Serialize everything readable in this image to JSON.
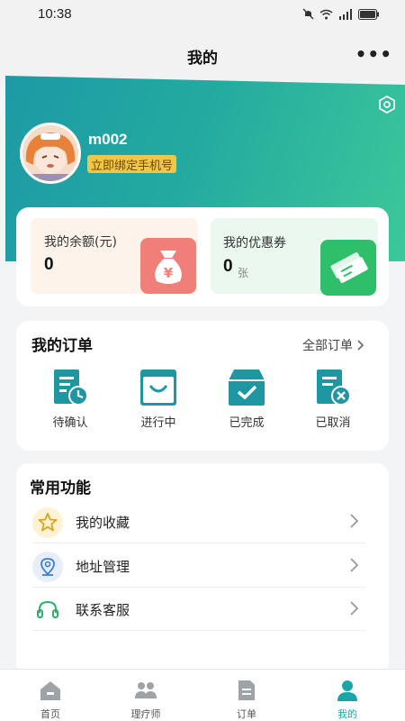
{
  "status_bar": {
    "time": "10:38"
  },
  "nav": {
    "title": "我的",
    "more": "•••"
  },
  "profile": {
    "username": "m002",
    "bind_phone": "立即绑定手机号"
  },
  "wallet": {
    "balance_label": "我的余额(元)",
    "balance_value": "0",
    "coupon_label": "我的优惠券",
    "coupon_value": "0",
    "coupon_unit": "张"
  },
  "orders": {
    "title": "我的订单",
    "all_label": "全部订单",
    "items": [
      {
        "label": "待确认"
      },
      {
        "label": "进行中"
      },
      {
        "label": "已完成"
      },
      {
        "label": "已取消"
      }
    ]
  },
  "features": {
    "title": "常用功能",
    "items": [
      {
        "label": "我的收藏",
        "icon": "star-icon"
      },
      {
        "label": "地址管理",
        "icon": "location-icon"
      },
      {
        "label": "联系客服",
        "icon": "headset-icon"
      }
    ]
  },
  "tabs": [
    {
      "label": "首页",
      "icon": "home-icon",
      "active": false
    },
    {
      "label": "理疗师",
      "icon": "therapist-icon",
      "active": false
    },
    {
      "label": "订单",
      "icon": "order-icon",
      "active": false
    },
    {
      "label": "我的",
      "icon": "profile-icon",
      "active": true
    }
  ],
  "colors": {
    "accent": "#1aa6a6",
    "order_icon": "#1f97a3",
    "balance_icon": "#f07f7a",
    "coupon_icon": "#2fbf6a",
    "bind_badge": "#f2c645"
  }
}
